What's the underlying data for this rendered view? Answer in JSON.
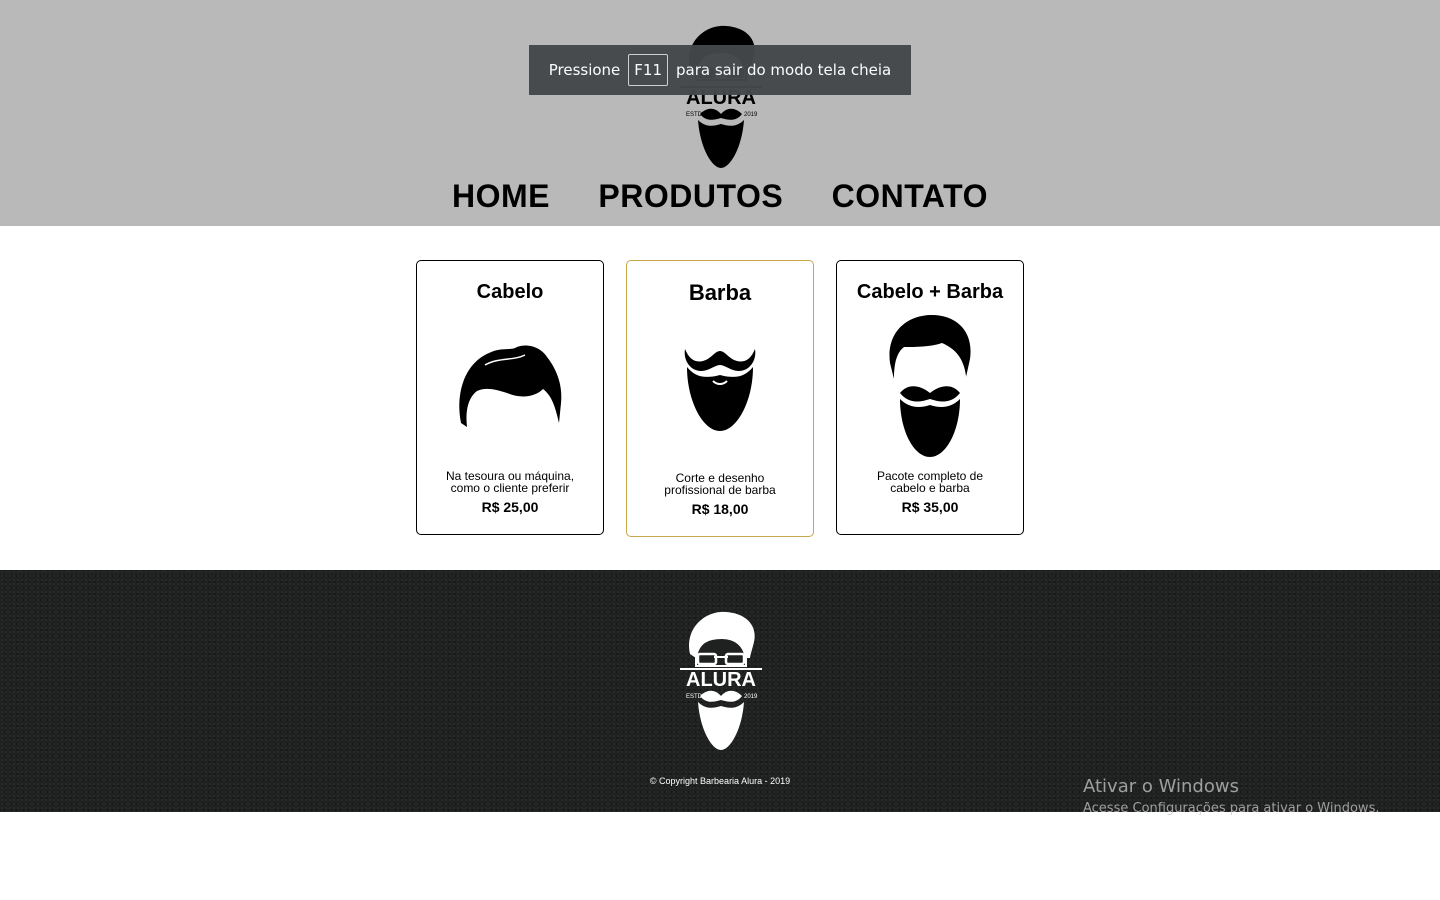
{
  "header": {
    "logo": {
      "icon": "barber-beard-logo-icon",
      "brand": "ALURA",
      "estd": "ESTD",
      "year": "2019"
    },
    "nav": [
      {
        "label": "HOME"
      },
      {
        "label": "PRODUTOS"
      },
      {
        "label": "CONTATO"
      }
    ]
  },
  "fullscreen_banner": {
    "before": "Pressione",
    "key": "F11",
    "after": "para sair do modo tela cheia"
  },
  "products": [
    {
      "title": "Cabelo",
      "icon": "hair-icon",
      "description": "Na tesoura ou máquina, como o cliente preferir",
      "price": "R$ 25,00"
    },
    {
      "title": "Barba",
      "icon": "beard-icon",
      "description": "Corte e desenho profissional de barba",
      "price": "R$ 18,00"
    },
    {
      "title": "Cabelo + Barba",
      "icon": "hair-and-beard-icon",
      "description": "Pacote completo de cabelo e barba",
      "price": "R$ 35,00"
    }
  ],
  "footer": {
    "logo": {
      "icon": "barber-beard-logo-icon",
      "brand": "ALURA",
      "estd": "ESTD",
      "year": "2019"
    },
    "copyright": "© Copyright Barbearia Alura - 2019"
  },
  "watermark": {
    "title": "Ativar o Windows",
    "subtitle": "Acesse Configurações para ativar o Windows."
  },
  "colors": {
    "header_bg": "#b9b9b9",
    "footer_bg": "#1f2020",
    "highlight_border": "#c8a64a",
    "banner_bg": "#45484b"
  }
}
